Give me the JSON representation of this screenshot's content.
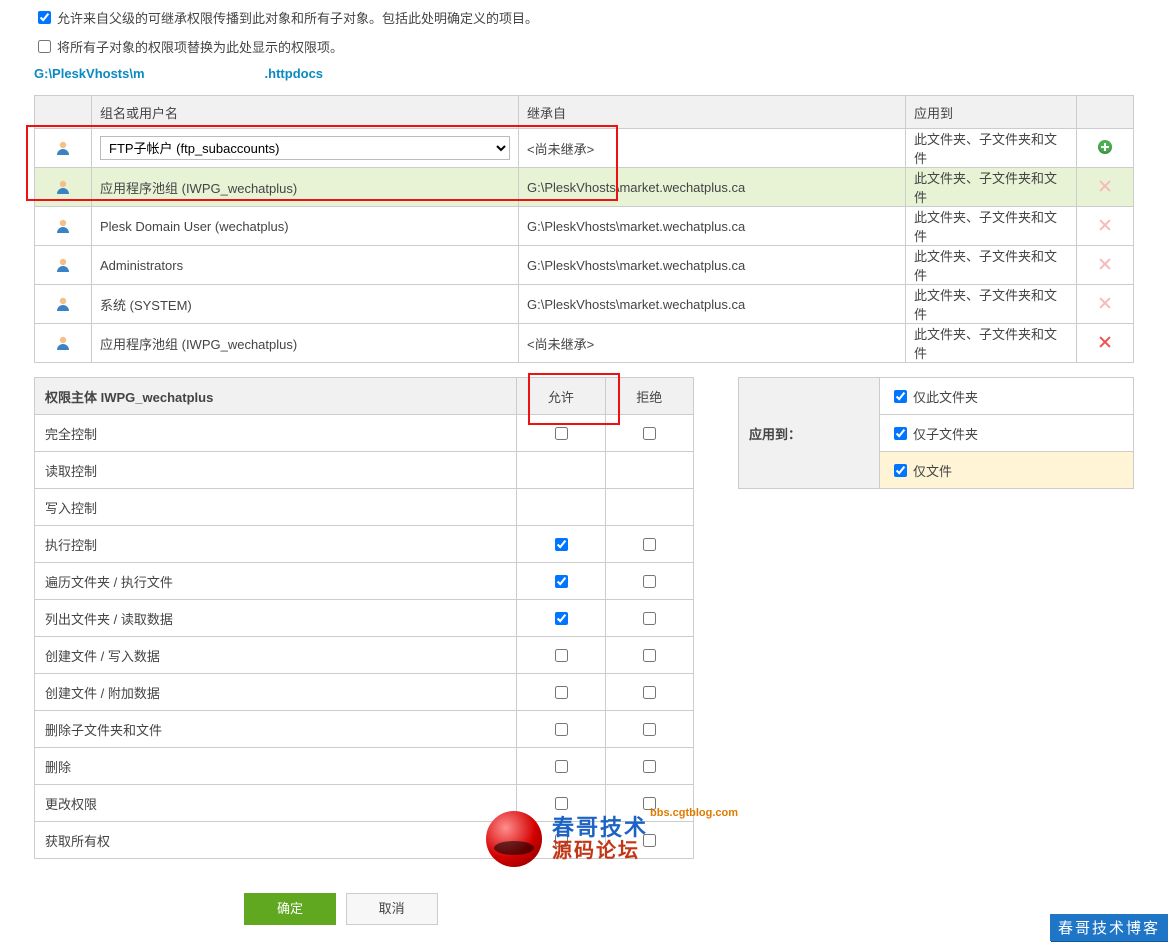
{
  "options": {
    "inherit_checked": true,
    "inherit_label": "允许来自父级的可继承权限传播到此对象和所有子对象。包括此处明确定义的项目。",
    "replace_checked": false,
    "replace_label": "将所有子对象的权限项替换为此处显示的权限项。"
  },
  "path": {
    "prefix": "G:\\PleskVhosts\\m",
    "suffix": ".httpdocs"
  },
  "table": {
    "headers": {
      "name": "组名或用户名",
      "inherit": "继承自",
      "apply": "应用到"
    },
    "rows": [
      {
        "sel": false,
        "isSelect": true,
        "name": "FTP子帐户 (ftp_subaccounts)",
        "inherit": "<尚未继承>",
        "apply": "此文件夹、子文件夹和文件",
        "act": "add"
      },
      {
        "sel": true,
        "name": "应用程序池组 (IWPG_wechatplus)",
        "inherit": "G:\\PleskVhosts\\market.wechatplus.ca",
        "apply": "此文件夹、子文件夹和文件",
        "act": "del-dis"
      },
      {
        "sel": false,
        "name": "Plesk Domain User (wechatplus)",
        "inherit": "G:\\PleskVhosts\\market.wechatplus.ca",
        "apply": "此文件夹、子文件夹和文件",
        "act": "del-dis"
      },
      {
        "sel": false,
        "name": "Administrators",
        "inherit": "G:\\PleskVhosts\\market.wechatplus.ca",
        "apply": "此文件夹、子文件夹和文件",
        "act": "del-dis"
      },
      {
        "sel": false,
        "name": "系统 (SYSTEM)",
        "inherit": "G:\\PleskVhosts\\market.wechatplus.ca",
        "apply": "此文件夹、子文件夹和文件",
        "act": "del-dis"
      },
      {
        "sel": false,
        "name": "应用程序池组 (IWPG_wechatplus)",
        "inherit": "<尚未继承>",
        "apply": "此文件夹、子文件夹和文件",
        "act": "del"
      }
    ]
  },
  "perm": {
    "title_prefix": "权限主体 ",
    "principal": "IWPG_wechatplus",
    "allow": "允许",
    "deny": "拒绝",
    "rows": [
      {
        "label": "完全控制",
        "allow": false,
        "deny": false
      },
      {
        "label": "读取控制",
        "allow": null,
        "deny": null
      },
      {
        "label": "写入控制",
        "allow": null,
        "deny": null
      },
      {
        "label": "执行控制",
        "allow": true,
        "deny": false
      },
      {
        "label": "遍历文件夹 / 执行文件",
        "allow": true,
        "deny": false
      },
      {
        "label": "列出文件夹 / 读取数据",
        "allow": true,
        "deny": false
      },
      {
        "label": "创建文件 / 写入数据",
        "allow": false,
        "deny": false
      },
      {
        "label": "创建文件 / 附加数据",
        "allow": false,
        "deny": false
      },
      {
        "label": "删除子文件夹和文件",
        "allow": false,
        "deny": false
      },
      {
        "label": "删除",
        "allow": false,
        "deny": false
      },
      {
        "label": "更改权限",
        "allow": false,
        "deny": false
      },
      {
        "label": "获取所有权",
        "allow": false,
        "deny": false
      }
    ]
  },
  "applyto": {
    "header": "应用到：",
    "items": [
      {
        "label": "仅此文件夹",
        "checked": true,
        "hl": false
      },
      {
        "label": "仅子文件夹",
        "checked": true,
        "hl": false
      },
      {
        "label": "仅文件",
        "checked": true,
        "hl": true
      }
    ]
  },
  "buttons": {
    "ok": "确定",
    "cancel": "取消"
  },
  "watermark": {
    "url": "bbs.cgtblog.com",
    "line1": "春哥技术",
    "line2": "源码论坛"
  },
  "stamp": "春哥技术博客"
}
